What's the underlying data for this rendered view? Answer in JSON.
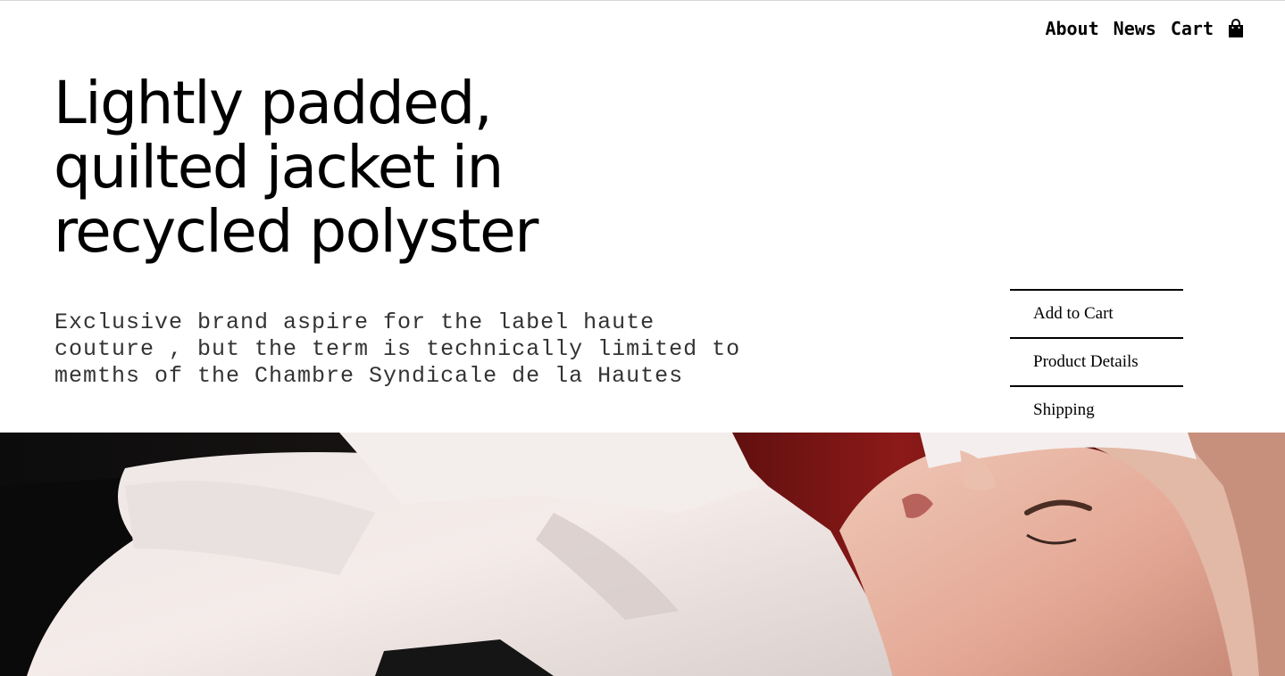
{
  "nav": {
    "about": "About",
    "news": "News",
    "cart": "Cart"
  },
  "product": {
    "title": "Lightly padded, quilted jacket in recycled polyster",
    "description": "Exclusive brand aspire for the label haute couture , but the term is technically limited to memths of the Chambre Syndicale de la Hautes"
  },
  "menu": {
    "items": [
      "Add to Cart",
      "Product Details",
      "Shipping"
    ]
  },
  "icons": {
    "cart": "shopping-bag-icon"
  },
  "hero": {
    "alt": "Woman lying down wearing a white satin shirt"
  }
}
